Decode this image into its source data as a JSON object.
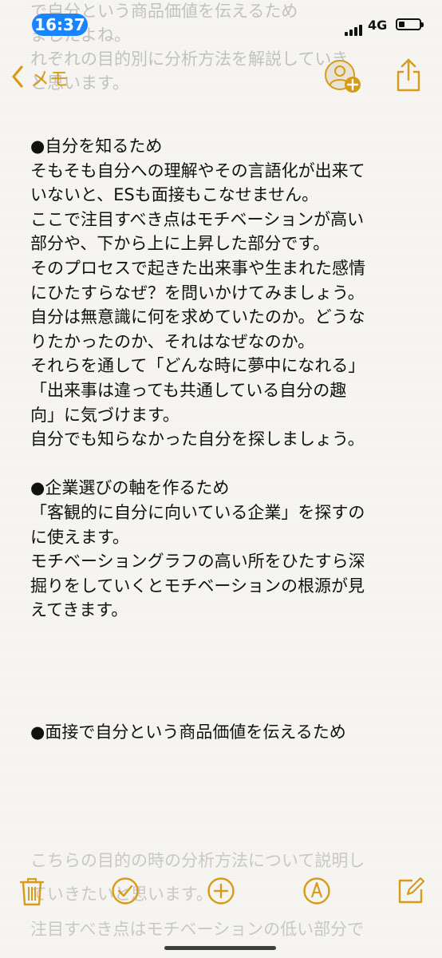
{
  "status": {
    "time": "16:37",
    "network": "4G"
  },
  "nav": {
    "back_label": "メモ"
  },
  "note": {
    "lines": [
      "●自分を知るため",
      "そもそも自分への理解やその言語化が出来て",
      "いないと、ESも面接もこなせません。",
      "ここで注目すべき点はモチベーションが高い",
      "部分や、下から上に上昇した部分です。",
      "そのプロセスで起きた出来事や生まれた感情",
      "にひたすらなぜ？を問いかけてみましょう。",
      "自分は無意識に何を求めていたのか。どうな",
      "りたかったのか、それはなぜなのか。",
      "それらを通して「どんな時に夢中になれる」",
      "「出来事は違っても共通している自分の趣",
      "向」に気づけます。",
      "自分でも知らなかった自分を探しましょう。",
      "",
      "●企業選びの軸を作るため",
      "「客観的に自分に向いている企業」を探すの",
      "に使えます。",
      "モチベーショングラフの高い所をひたすら深",
      "掘りをしていくとモチベーションの根源が見",
      "えてきます。",
      "",
      "",
      "",
      "",
      "●面接で自分という商品価値を伝えるため"
    ],
    "faded_under_toolbar": [
      "こちらの目的の時の分析方法について説明し",
      "ていきたいと思います。",
      "注目すべき点はモチベーションの低い部分で"
    ]
  },
  "toolbar": {
    "icons": [
      "trash-icon",
      "checklist-icon",
      "add-icon",
      "markup-icon",
      "compose-icon"
    ]
  },
  "colors": {
    "accent": "#d79b18",
    "time_pill": "#1a84ff",
    "background": "#f6f5f2"
  }
}
